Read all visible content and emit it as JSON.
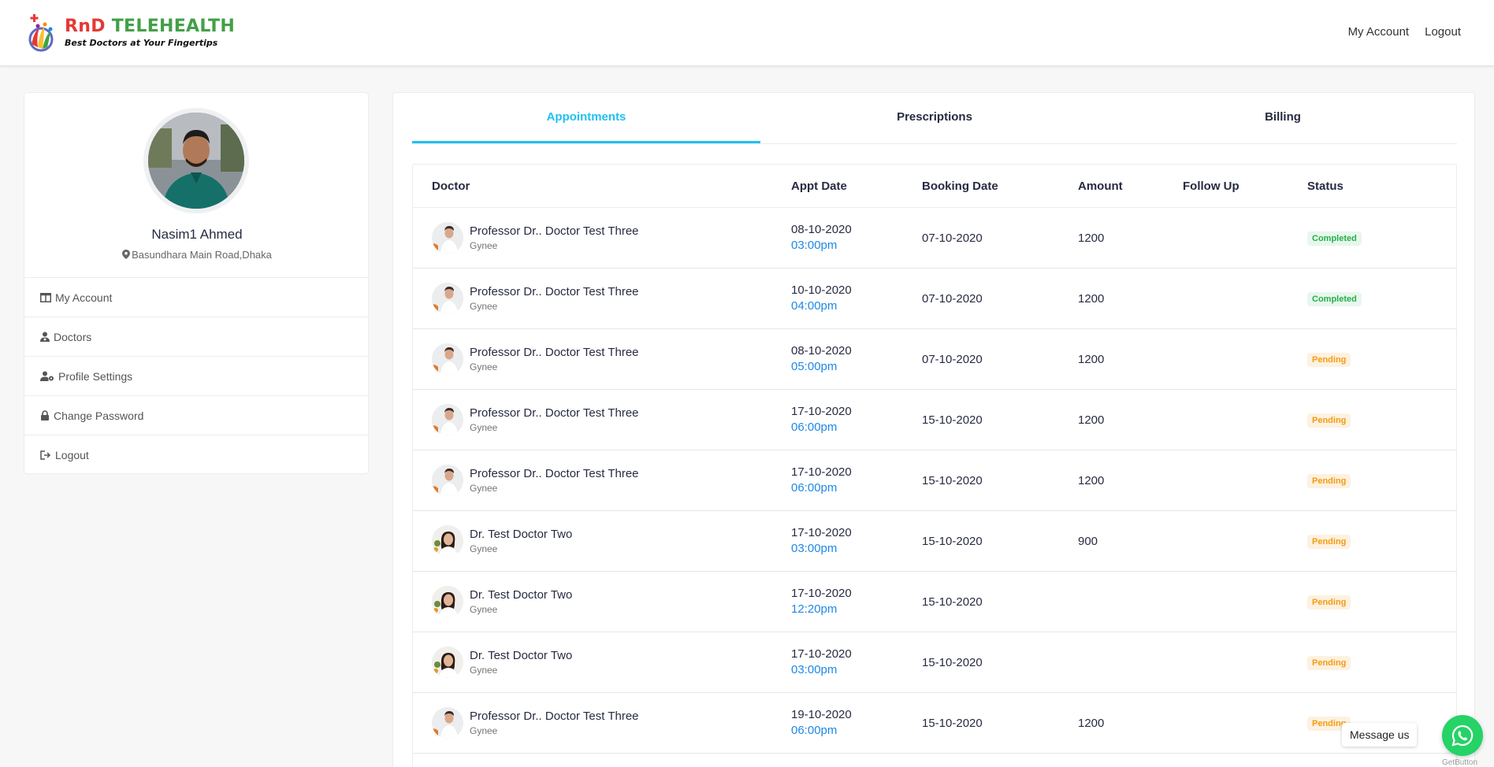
{
  "brand": {
    "name_part1": "RnD",
    "name_part2": "TELEHEALTH",
    "tagline": "Best Doctors at Your Fingertips"
  },
  "top_nav": {
    "my_account": "My Account",
    "logout": "Logout"
  },
  "profile": {
    "name": "Nasim1 Ahmed",
    "location": "Basundhara Main Road,Dhaka"
  },
  "sidebar": {
    "items": [
      {
        "label": "My Account",
        "icon": "columns-icon"
      },
      {
        "label": "Doctors",
        "icon": "user-md-icon"
      },
      {
        "label": "Profile Settings",
        "icon": "user-cog-icon"
      },
      {
        "label": "Change Password",
        "icon": "lock-icon"
      },
      {
        "label": "Logout",
        "icon": "sign-out-icon"
      }
    ]
  },
  "tabs": [
    "Appointments",
    "Prescriptions",
    "Billing"
  ],
  "active_tab": "Appointments",
  "table": {
    "headers": [
      "Doctor",
      "Appt Date",
      "Booking Date",
      "Amount",
      "Follow Up",
      "Status"
    ],
    "rows": [
      {
        "doctor": "Professor Dr.. Doctor Test Three",
        "spec": "Gynee",
        "appt_date": "08-10-2020",
        "appt_time": "03:00pm",
        "booking": "07-10-2020",
        "amount": "1200",
        "follow_up": "",
        "status": "Completed"
      },
      {
        "doctor": "Professor Dr.. Doctor Test Three",
        "spec": "Gynee",
        "appt_date": "10-10-2020",
        "appt_time": "04:00pm",
        "booking": "07-10-2020",
        "amount": "1200",
        "follow_up": "",
        "status": "Completed"
      },
      {
        "doctor": "Professor Dr.. Doctor Test Three",
        "spec": "Gynee",
        "appt_date": "08-10-2020",
        "appt_time": "05:00pm",
        "booking": "07-10-2020",
        "amount": "1200",
        "follow_up": "",
        "status": "Pending"
      },
      {
        "doctor": "Professor Dr.. Doctor Test Three",
        "spec": "Gynee",
        "appt_date": "17-10-2020",
        "appt_time": "06:00pm",
        "booking": "15-10-2020",
        "amount": "1200",
        "follow_up": "",
        "status": "Pending"
      },
      {
        "doctor": "Professor Dr.. Doctor Test Three",
        "spec": "Gynee",
        "appt_date": "17-10-2020",
        "appt_time": "06:00pm",
        "booking": "15-10-2020",
        "amount": "1200",
        "follow_up": "",
        "status": "Pending"
      },
      {
        "doctor": "Dr. Test Doctor Two",
        "spec": "Gynee",
        "appt_date": "17-10-2020",
        "appt_time": "03:00pm",
        "booking": "15-10-2020",
        "amount": "900",
        "follow_up": "",
        "status": "Pending"
      },
      {
        "doctor": "Dr. Test Doctor Two",
        "spec": "Gynee",
        "appt_date": "17-10-2020",
        "appt_time": "12:20pm",
        "booking": "15-10-2020",
        "amount": "",
        "follow_up": "",
        "status": "Pending"
      },
      {
        "doctor": "Dr. Test Doctor Two",
        "spec": "Gynee",
        "appt_date": "17-10-2020",
        "appt_time": "03:00pm",
        "booking": "15-10-2020",
        "amount": "",
        "follow_up": "",
        "status": "Pending"
      },
      {
        "doctor": "Professor Dr.. Doctor Test Three",
        "spec": "Gynee",
        "appt_date": "19-10-2020",
        "appt_time": "06:00pm",
        "booking": "15-10-2020",
        "amount": "1200",
        "follow_up": "",
        "status": "Pending"
      }
    ]
  },
  "widget": {
    "message_label": "Message us",
    "provider": "GetButton"
  },
  "colors": {
    "accent": "#20c0f3",
    "time": "#1e88e5",
    "completed": "#26af48",
    "pending": "#f39c12",
    "whatsapp": "#25d366"
  }
}
